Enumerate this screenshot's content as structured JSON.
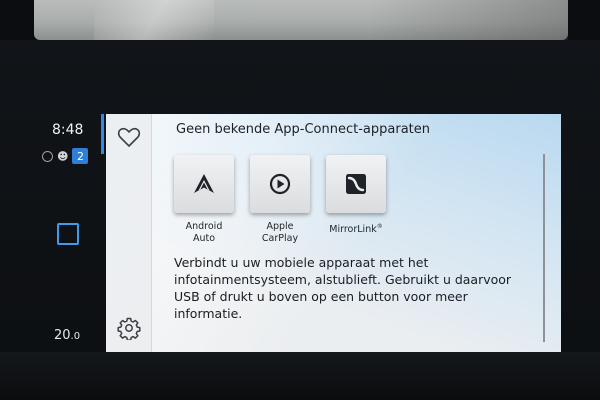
{
  "status": {
    "time": "8:48",
    "notification_count": "2",
    "temperature_int": "20",
    "temperature_dec": ".0"
  },
  "panel": {
    "title": "Geen bekende App-Connect-apparaten",
    "tiles": [
      {
        "line1": "Android",
        "line2": "Auto",
        "icon": "android-auto-icon"
      },
      {
        "line1": "Apple",
        "line2": "CarPlay",
        "icon": "apple-carplay-icon"
      },
      {
        "line1": "MirrorLink",
        "sup": "®",
        "icon": "mirrorlink-icon"
      }
    ],
    "description": "Verbindt u uw mobiele apparaat met het infotainmentsysteem, alstublieft. Gebruikt u daarvoor USB of drukt u boven op een button voor meer informatie."
  },
  "colors": {
    "accent": "#2e8ae6",
    "badge": "#2f7fd6"
  }
}
